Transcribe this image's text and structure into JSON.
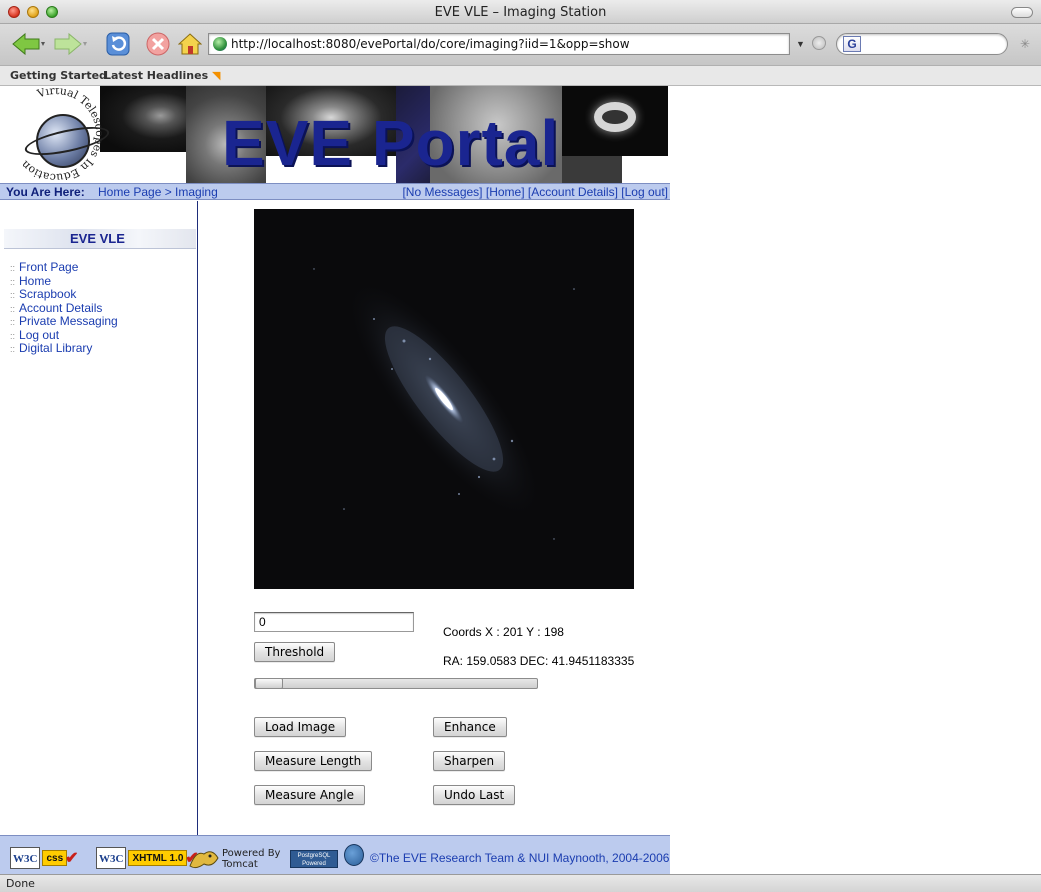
{
  "window": {
    "title": "EVE VLE – Imaging Station"
  },
  "browser": {
    "url": "http://localhost:8080/evePortal/do/core/imaging?iid=1&opp=show",
    "bookmarks": [
      "Getting Started",
      "Latest Headlines"
    ],
    "status": "Done"
  },
  "header": {
    "logo_text": "Virtual Telescopes In Education",
    "title": "EVE Portal"
  },
  "breadcrumb": {
    "label": "You Are Here:",
    "path": "Home Page > Imaging",
    "links": [
      "[No Messages]",
      "[Home]",
      "[Account Details]",
      "[Log out]"
    ]
  },
  "sidebar": {
    "title": "EVE VLE",
    "items": [
      "Front Page",
      "Home",
      "Scrapbook",
      "Account Details",
      "Private Messaging",
      "Log out",
      "Digital Library"
    ]
  },
  "imaging": {
    "threshold_value": "0",
    "threshold_button": "Threshold",
    "slider_fraction": 0.0,
    "coords": "Coords X : 201 Y : 198",
    "radec": "RA: 159.0583 DEC: 41.9451183335",
    "buttons": {
      "load_image": "Load Image",
      "enhance": "Enhance",
      "measure_length": "Measure Length",
      "sharpen": "Sharpen",
      "measure_angle": "Measure Angle",
      "undo_last": "Undo Last"
    }
  },
  "footer": {
    "w3c_css": "W3C",
    "css_chip": "css",
    "w3c_xhtml": "W3C",
    "xhtml_chip": "XHTML 1.0",
    "powered_by": "Powered By",
    "tomcat": "Tomcat",
    "postgres": "PostgreSQL Powered",
    "copyright": "©The EVE Research Team & NUI Maynooth, 2004-2006"
  },
  "colors": {
    "nav_blue": "#bccbee",
    "link_blue": "#1b3db0",
    "title_blue": "#1a2590"
  }
}
